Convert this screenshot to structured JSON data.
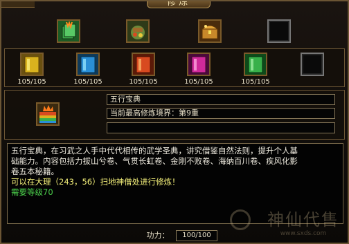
{
  "window": {
    "title": "修炼"
  },
  "top_slots": [
    {
      "icon": "green-manual-book-icon",
      "color": "#3da84a"
    },
    {
      "icon": "supply-sack-icon",
      "color": "#6a8a3a"
    },
    {
      "icon": "treasure-chest-icon",
      "color": "#c8882a"
    },
    {
      "icon": "empty-slot",
      "color": "#222222"
    }
  ],
  "book_slots": [
    {
      "icon": "yellow-book-icon",
      "color": "#d9b21e",
      "count": "105/105"
    },
    {
      "icon": "blue-book-icon",
      "color": "#2a8fd6",
      "count": "105/105"
    },
    {
      "icon": "red-book-icon",
      "color": "#d84a20",
      "count": "105/105"
    },
    {
      "icon": "pink-book-icon",
      "color": "#d02a9a",
      "count": "105/105"
    },
    {
      "icon": "green-book-icon",
      "color": "#38b04a",
      "count": "105/105"
    },
    {
      "icon": "empty-slot",
      "color": "#222222",
      "count": ""
    }
  ],
  "selected": {
    "icon": "five-elements-manual-icon",
    "name": "五行宝典",
    "realm": "当前最高修炼境界：第9重",
    "extra": ""
  },
  "description": {
    "line1": "五行宝典，在习武之人手中代代相传的武学圣典，讲究借鉴自然法则，提升个人基",
    "line2": "础能力。内容包括力拔山兮卷、气贯长虹卷、金刚不败卷、海纳百川卷、疾风化影",
    "line3": "卷五本秘籍。",
    "line4": "可以在大理（243，56）扫地神僧处进行修炼！",
    "line5": "需要等级70"
  },
  "power": {
    "label": "功力：",
    "value": "100/100"
  },
  "watermark": {
    "brand": "神仙代售",
    "url": "www.sxds.com"
  }
}
